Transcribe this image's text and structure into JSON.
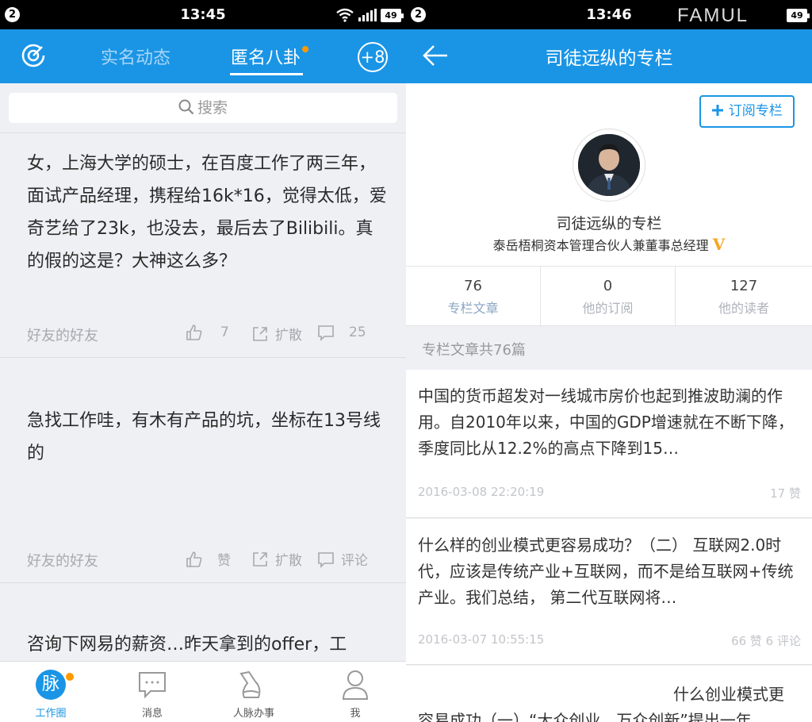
{
  "left": {
    "status": {
      "badge": "2",
      "time": "13:45",
      "battery": "49"
    },
    "tabs": [
      {
        "label": "实名动态"
      },
      {
        "label": "匿名八卦"
      }
    ],
    "plus_label": "+8",
    "search_placeholder": "搜索",
    "posts": [
      {
        "text": "女，上海大学的硕士，在百度工作了两三年，面试产品经理，携程给16k*16，觉得太低，爱奇艺给了23k，也没去，最后去了Bilibili。真的假的这是？大神这么多？",
        "source": "好友的好友",
        "like": "7",
        "share": "扩散",
        "comment": "25"
      },
      {
        "text": "急找工作哇，有木有产品的坑，坐标在13号线的",
        "source": "好友的好友",
        "like": "赞",
        "share": "扩散",
        "comment": "评论"
      },
      {
        "text": "咨询下网易的薪资…昨天拿到的offer，工",
        "source": "",
        "like": "",
        "share": "",
        "comment": ""
      }
    ],
    "tabbar": [
      {
        "label": "工作圈",
        "glyph": "脉"
      },
      {
        "label": "消息"
      },
      {
        "label": "人脉办事"
      },
      {
        "label": "我"
      }
    ]
  },
  "right": {
    "status": {
      "badge": "2",
      "time": "13:46",
      "battery": "49",
      "watermark": "FAMUL"
    },
    "title": "司徒远纵的专栏",
    "subscribe_label": "订阅专栏",
    "column_name": "司徒远纵的专栏",
    "column_subtitle": "泰岳梧桐资本管理合伙人兼董事总经理",
    "verified": "V",
    "stats": [
      {
        "value": "76",
        "label": "专栏文章"
      },
      {
        "value": "0",
        "label": "他的订阅"
      },
      {
        "value": "127",
        "label": "他的读者"
      }
    ],
    "section_header": "专栏文章共76篇",
    "articles": [
      {
        "text": "中国的货币超发对一线城市房价也起到推波助澜的作用。自2010年以来，中国的GDP增速就在不断下降，季度同比从12.2%的高点下降到15…",
        "date": "2016-03-08 22:20:19",
        "meta": "17 赞"
      },
      {
        "text": "什么样的创业模式更容易成功？（二） 互联网2.0时代，应该是传统产业+互联网，而不是给互联网+传统产业。我们总结， 第二代互联网将…",
        "date": "2016-03-07 10:55:15",
        "meta": "66 赞 6 评论"
      },
      {
        "text": "什么创业模式更",
        "text2": "容易成功（一）“大众创业，万众创新”提出一年",
        "date": "",
        "meta": ""
      }
    ]
  }
}
